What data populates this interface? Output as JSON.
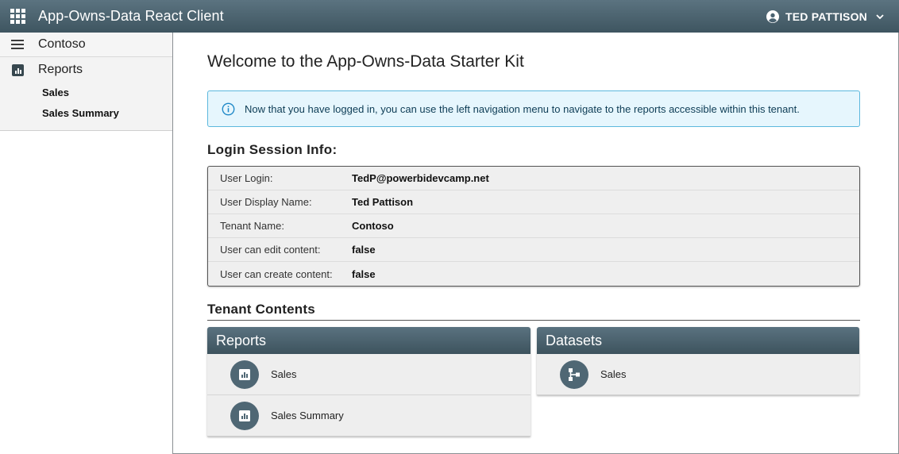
{
  "header": {
    "title": "App-Owns-Data React Client",
    "user_name": "TED PATTISON",
    "apps_icon": "apps-grid-icon",
    "user_icon": "account-circle-icon",
    "dropdown_icon": "chevron-down-icon"
  },
  "sidebar": {
    "tenant_label": "Contoso",
    "reports_label": "Reports",
    "items": [
      {
        "label": "Sales"
      },
      {
        "label": "Sales Summary"
      }
    ]
  },
  "main": {
    "title": "Welcome to the App-Owns-Data Starter Kit",
    "info_text": "Now that you have logged in, you can use the left navigation menu to navigate to the reports accessible within this tenant.",
    "session_title": "Login Session Info:",
    "session_rows": [
      {
        "label": "User Login:",
        "value": "TedP@powerbidevcamp.net"
      },
      {
        "label": "User Display Name:",
        "value": "Ted Pattison"
      },
      {
        "label": "Tenant Name:",
        "value": "Contoso"
      },
      {
        "label": "User can edit content:",
        "value": "false"
      },
      {
        "label": "User can create content:",
        "value": "false"
      }
    ],
    "tenant_contents_title": "Tenant Contents",
    "reports_card": {
      "title": "Reports",
      "items": [
        {
          "label": "Sales"
        },
        {
          "label": "Sales Summary"
        }
      ]
    },
    "datasets_card": {
      "title": "Datasets",
      "items": [
        {
          "label": "Sales"
        }
      ]
    }
  },
  "colors": {
    "appbar": "#4a6270",
    "info_bg": "#e6f6fd",
    "info_border": "#5cb8dd",
    "icon_circle": "#4f6774"
  }
}
